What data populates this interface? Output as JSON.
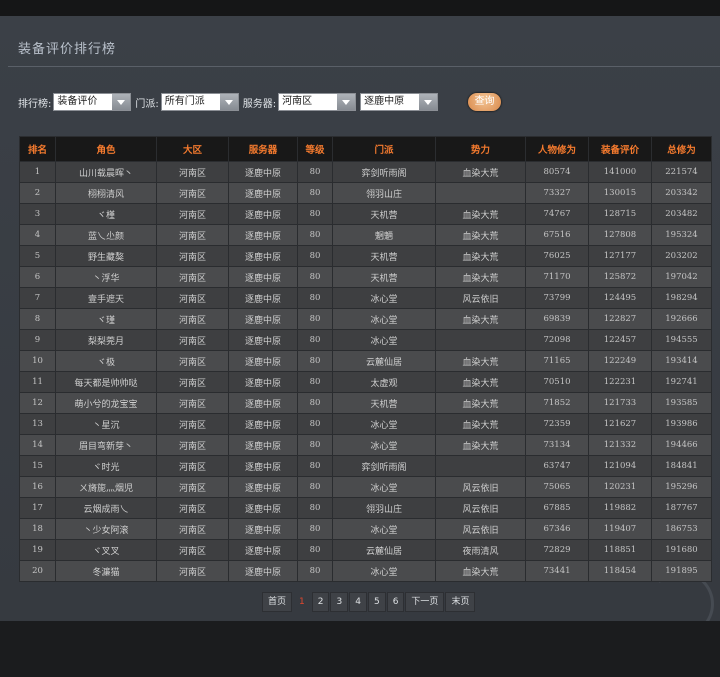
{
  "page_title": "装备评价排行榜",
  "filters": {
    "rank_label": "排行榜:",
    "rank_value": "装备评价",
    "school_label": "门派:",
    "school_value": "所有门派",
    "server_label": "服务器:",
    "region_value": "河南区",
    "server_value": "逐鹿中原",
    "query_button": "查询"
  },
  "table": {
    "headers": [
      "排名",
      "角色",
      "大区",
      "服务器",
      "等级",
      "门派",
      "势力",
      "人物修为",
      "装备评价",
      "总修为"
    ],
    "rows": [
      [
        "1",
        "山川载晨晖丶",
        "河南区",
        "逐鹿中原",
        "80",
        "弈剑听雨阁",
        "血染大荒",
        "80574",
        "141000",
        "221574"
      ],
      [
        "2",
        "栩栩清风",
        "河南区",
        "逐鹿中原",
        "80",
        "翎羽山庄",
        "",
        "73327",
        "130015",
        "203342"
      ],
      [
        "3",
        "ヾ槿",
        "河南区",
        "逐鹿中原",
        "80",
        "天机营",
        "血染大荒",
        "74767",
        "128715",
        "203482"
      ],
      [
        "4",
        "蓝乀尐颜",
        "河南区",
        "逐鹿中原",
        "80",
        "魍魉",
        "血染大荒",
        "67516",
        "127808",
        "195324"
      ],
      [
        "5",
        "野生藏獒",
        "河南区",
        "逐鹿中原",
        "80",
        "天机营",
        "血染大荒",
        "76025",
        "127177",
        "203202"
      ],
      [
        "6",
        "丶浮华",
        "河南区",
        "逐鹿中原",
        "80",
        "天机营",
        "血染大荒",
        "71170",
        "125872",
        "197042"
      ],
      [
        "7",
        "壹手遮天",
        "河南区",
        "逐鹿中原",
        "80",
        "冰心堂",
        "风云依旧",
        "73799",
        "124495",
        "198294"
      ],
      [
        "8",
        "ヾ瑾",
        "河南区",
        "逐鹿中原",
        "80",
        "冰心堂",
        "血染大荒",
        "69839",
        "122827",
        "192666"
      ],
      [
        "9",
        "梨梨莞月",
        "河南区",
        "逐鹿中原",
        "80",
        "冰心堂",
        "",
        "72098",
        "122457",
        "194555"
      ],
      [
        "10",
        "ヾ极",
        "河南区",
        "逐鹿中原",
        "80",
        "云麓仙居",
        "血染大荒",
        "71165",
        "122249",
        "193414"
      ],
      [
        "11",
        "每天都是帅帅哒",
        "河南区",
        "逐鹿中原",
        "80",
        "太虚观",
        "血染大荒",
        "70510",
        "122231",
        "192741"
      ],
      [
        "12",
        "萌小兮的龙宝宝",
        "河南区",
        "逐鹿中原",
        "80",
        "天机营",
        "血染大荒",
        "71852",
        "121733",
        "193585"
      ],
      [
        "13",
        "丶星沉",
        "河南区",
        "逐鹿中原",
        "80",
        "冰心堂",
        "血染大荒",
        "72359",
        "121627",
        "193986"
      ],
      [
        "14",
        "眉目弯新芽丶",
        "河南区",
        "逐鹿中原",
        "80",
        "冰心堂",
        "血染大荒",
        "73134",
        "121332",
        "194466"
      ],
      [
        "15",
        "ヾ时光",
        "河南区",
        "逐鹿中原",
        "80",
        "弈剑听雨阁",
        "",
        "63747",
        "121094",
        "184841"
      ],
      [
        "16",
        "ㄨ旖旎灬烟児",
        "河南区",
        "逐鹿中原",
        "80",
        "冰心堂",
        "风云依旧",
        "75065",
        "120231",
        "195296"
      ],
      [
        "17",
        "云烟成雨乀",
        "河南区",
        "逐鹿中原",
        "80",
        "翎羽山庄",
        "风云依旧",
        "67885",
        "119882",
        "187767"
      ],
      [
        "18",
        "丶少女阿滚",
        "河南区",
        "逐鹿中原",
        "80",
        "冰心堂",
        "风云依旧",
        "67346",
        "119407",
        "186753"
      ],
      [
        "19",
        "ヾ叉叉",
        "河南区",
        "逐鹿中原",
        "80",
        "云麓仙居",
        "夜雨清风",
        "72829",
        "118851",
        "191680"
      ],
      [
        "20",
        "冬濂猫",
        "河南区",
        "逐鹿中原",
        "80",
        "冰心堂",
        "血染大荒",
        "73441",
        "118454",
        "191895"
      ]
    ]
  },
  "pager": {
    "first": "首页",
    "pages": [
      "1",
      "2",
      "3",
      "4",
      "5",
      "6"
    ],
    "current": "1",
    "next": "下一页",
    "last": "末页"
  }
}
